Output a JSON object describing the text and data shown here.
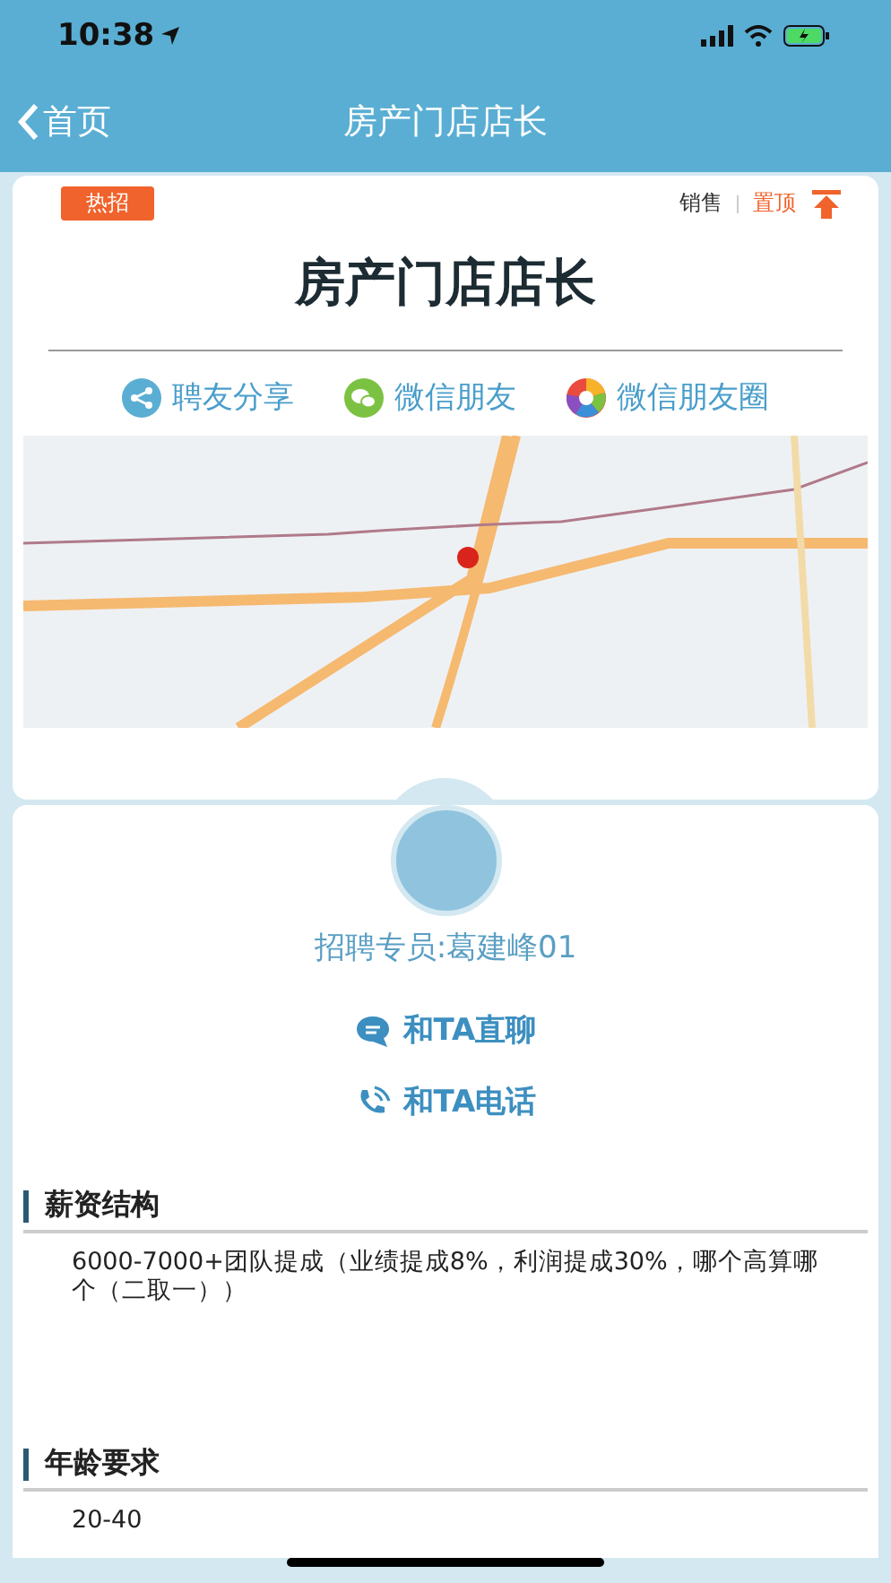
{
  "status_bar": {
    "time": "10:38"
  },
  "nav": {
    "back": "首页",
    "title": "房产门店店长"
  },
  "job": {
    "tag": "热招",
    "category": "销售",
    "pin": "置顶",
    "title": "房产门店店长"
  },
  "share": [
    {
      "kind": "share",
      "label": "聘友分享"
    },
    {
      "kind": "wechat",
      "label": "微信朋友"
    },
    {
      "kind": "moments",
      "label": "微信朋友圈"
    }
  ],
  "recruiter": {
    "name": "招聘专员:葛建峰01",
    "actions": [
      {
        "kind": "chat",
        "label": "和TA直聊"
      },
      {
        "kind": "phone",
        "label": "和TA电话"
      }
    ]
  },
  "sections": [
    {
      "heading": "薪资结构",
      "body": "6000-7000+团队提成（业绩提成8%，利润提成30%，哪个高算哪个（二取一））"
    },
    {
      "heading": "年龄要求",
      "body": "20-40"
    }
  ]
}
